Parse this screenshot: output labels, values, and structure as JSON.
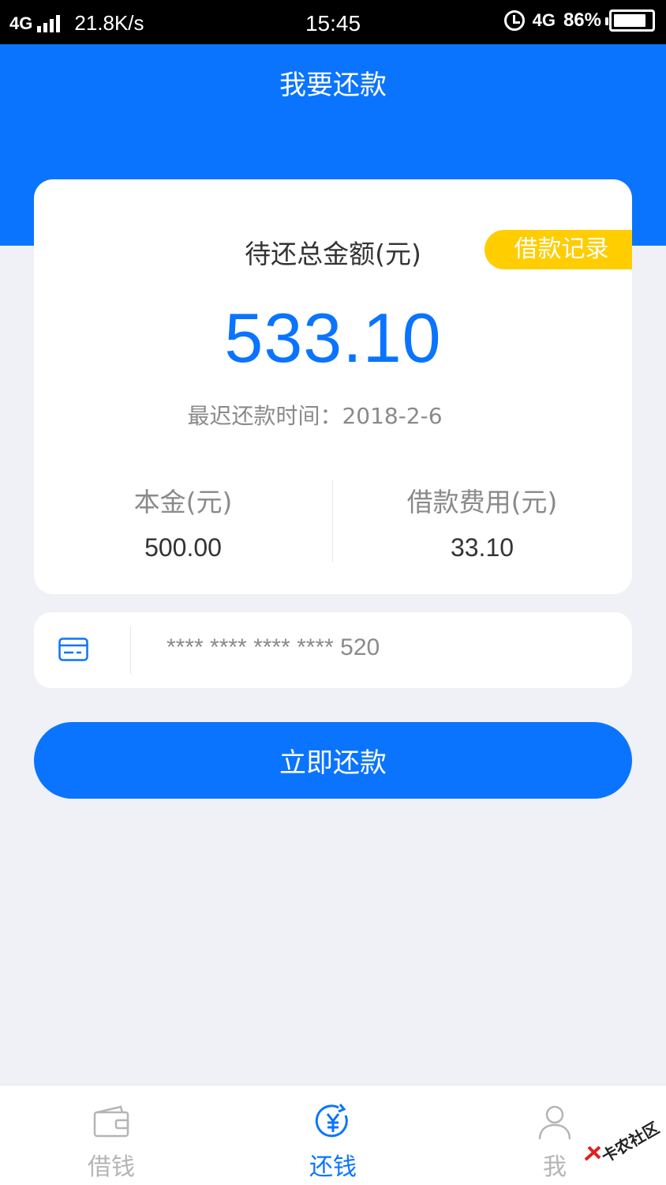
{
  "status_bar": {
    "network_left": "4G",
    "speed": "21.8K/s",
    "time": "15:45",
    "network_right": "4G",
    "battery": "86%",
    "battery_level": 0.86
  },
  "header": {
    "title": "我要还款"
  },
  "summary": {
    "total_label": "待还总金额(元)",
    "record_tag": "借款记录",
    "total_amount": "533.10",
    "due_date": "最迟还款时间：2018-2-6",
    "principal_label": "本金(元)",
    "principal_value": "500.00",
    "fee_label": "借款费用(元)",
    "fee_value": "33.10"
  },
  "bank_card": {
    "icon": "bank-card-icon",
    "number": "**** **** **** **** 520"
  },
  "actions": {
    "repay_button": "立即还款"
  },
  "tab_bar": {
    "items": [
      {
        "label": "借钱",
        "icon": "wallet-icon",
        "active": false
      },
      {
        "label": "还钱",
        "icon": "yuan-repay-icon",
        "active": true
      },
      {
        "label": "我",
        "icon": "user-icon",
        "active": false
      }
    ]
  },
  "watermark": {
    "text": "卡农社区"
  },
  "colors": {
    "primary": "#0a74ff",
    "tag": "#ffcd00",
    "background": "#eff1f6",
    "muted": "#8a8a8a",
    "inactive_tab": "#b5b5b5"
  }
}
